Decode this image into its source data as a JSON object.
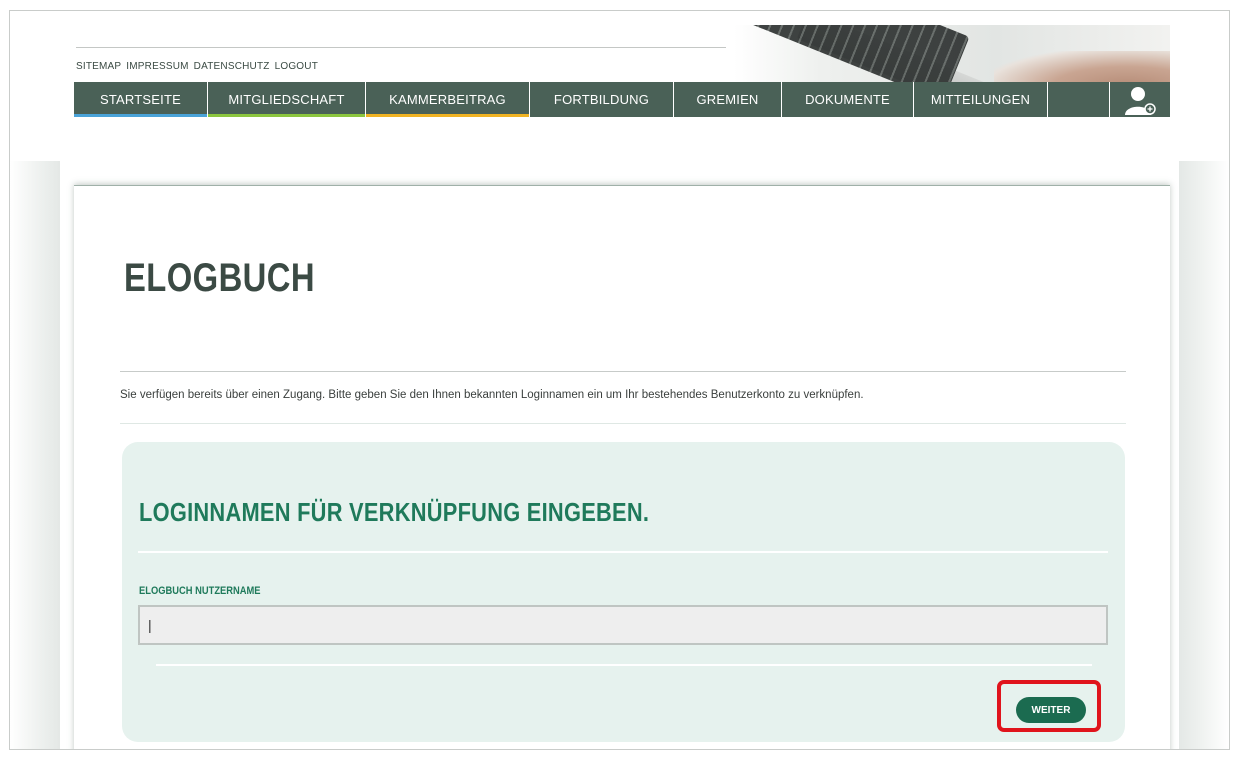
{
  "util_links": [
    "SITEMAP",
    "IMPRESSUM",
    "DATENSCHUTZ",
    "LOGOUT"
  ],
  "nav": {
    "items": [
      {
        "label": "STARTSEITE",
        "accent": "#4aa3d8"
      },
      {
        "label": "MITGLIEDSCHAFT",
        "accent": "#8cc63f"
      },
      {
        "label": "KAMMERBEITRAG",
        "accent": "#f0b323"
      },
      {
        "label": "FORTBILDUNG",
        "accent": ""
      },
      {
        "label": "GREMIEN",
        "accent": ""
      },
      {
        "label": "DOKUMENTE",
        "accent": ""
      },
      {
        "label": "MITTEILUNGEN",
        "accent": ""
      }
    ],
    "user_icon": "user-icon"
  },
  "main": {
    "title": "ELOGBUCH",
    "intro": "Sie verfügen bereits über einen Zugang. Bitte geben Sie den Ihnen bekannten Loginnamen ein um Ihr bestehendes Benutzerkonto zu verknüpfen.",
    "panel": {
      "title": "LOGINNAMEN FÜR VERKNÜPFUNG EINGEBEN.",
      "field_label": "ELOGBUCH NUTZERNAME",
      "field_value": "|",
      "button_label": "WEITER"
    }
  },
  "colors": {
    "nav_bg": "#4a6157",
    "brand_green": "#1f7a5b",
    "button_bg": "#1b6b50",
    "panel_bg": "#e6f2ee",
    "highlight": "#e0141c"
  }
}
